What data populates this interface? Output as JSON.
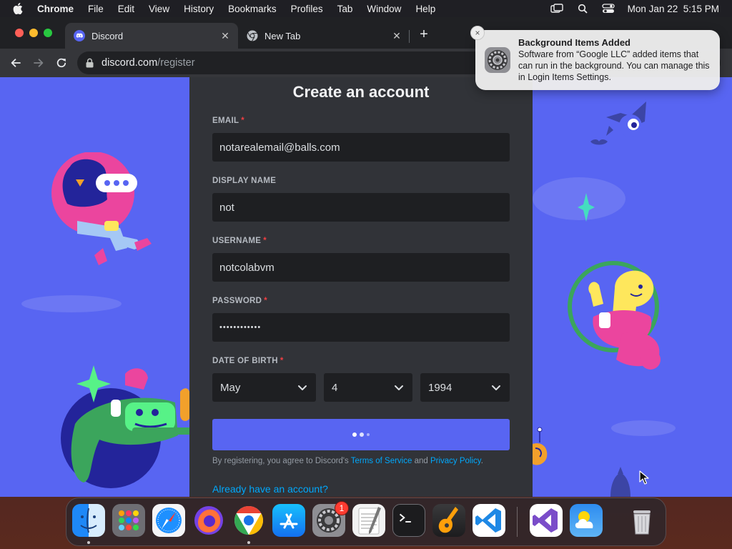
{
  "menubar": {
    "app_name": "Chrome",
    "items": [
      "File",
      "Edit",
      "View",
      "History",
      "Bookmarks",
      "Profiles",
      "Tab",
      "Window",
      "Help"
    ],
    "datetime": "Mon Jan 22  5:15 PM"
  },
  "browser": {
    "tabs": [
      {
        "label": "Discord",
        "icon": "discord-icon",
        "active": true
      },
      {
        "label": "New Tab",
        "icon": "chrome-icon",
        "active": false
      }
    ],
    "url_host": "discord.com",
    "url_path": "/register"
  },
  "form": {
    "title": "Create an account",
    "email_label": "EMAIL",
    "email_value": "notarealemail@balls.com",
    "display_name_label": "DISPLAY NAME",
    "display_name_value": "not",
    "username_label": "USERNAME",
    "username_value": "notcolabvm",
    "password_label": "PASSWORD",
    "password_value": "••••••••••••",
    "dob_label": "DATE OF BIRTH",
    "required_mark": "*",
    "dob_month": "May",
    "dob_day": "4",
    "dob_year": "1994",
    "legal_prefix": "By registering, you agree to Discord's ",
    "terms_link": "Terms of Service",
    "legal_and": " and ",
    "privacy_link": "Privacy Policy",
    "legal_suffix": ".",
    "login_link": "Already have an account?"
  },
  "notification": {
    "title": "Background Items Added",
    "body": "Software from “Google LLC” added items that can run in the background. You can manage this in Login Items Settings.",
    "close": "×"
  },
  "dock": {
    "apps": [
      "finder",
      "launchpad",
      "safari",
      "firefox",
      "chrome",
      "app-store",
      "system-settings",
      "textedit",
      "terminal",
      "garageband",
      "vscode",
      "visual-studio",
      "weather",
      "trash"
    ],
    "settings_badge": "1"
  },
  "colors": {
    "discord_blurple": "#5865f2",
    "card_bg": "#313338",
    "input_bg": "#1e1f22",
    "link": "#00a8fc"
  }
}
